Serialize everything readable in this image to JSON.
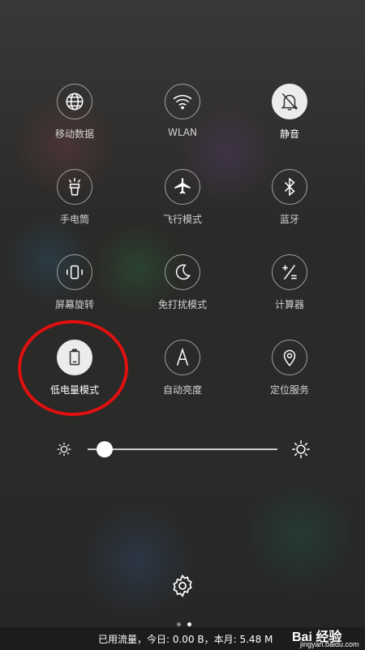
{
  "tiles": [
    {
      "label": "移动数据",
      "icon": "globe-icon",
      "active": false
    },
    {
      "label": "WLAN",
      "icon": "wifi-icon",
      "active": false
    },
    {
      "label": "静音",
      "icon": "bell-off-icon",
      "active": true
    },
    {
      "label": "手电筒",
      "icon": "flashlight-icon",
      "active": false
    },
    {
      "label": "飞行模式",
      "icon": "airplane-icon",
      "active": false
    },
    {
      "label": "蓝牙",
      "icon": "bluetooth-icon",
      "active": false
    },
    {
      "label": "屏幕旋转",
      "icon": "rotate-icon",
      "active": false
    },
    {
      "label": "免打扰模式",
      "icon": "moon-icon",
      "active": false
    },
    {
      "label": "计算器",
      "icon": "calculator-icon",
      "active": false
    },
    {
      "label": "低电量模式",
      "icon": "battery-icon",
      "active": true
    },
    {
      "label": "自动亮度",
      "icon": "auto-brightness-icon",
      "active": false
    },
    {
      "label": "定位服务",
      "icon": "location-icon",
      "active": false
    }
  ],
  "brightness": {
    "level_fraction": 0.09
  },
  "pager": {
    "pages": 2,
    "current": 2
  },
  "footer": {
    "data_usage": "已用流量，今日: 0.00 B，本月: 5.48 M"
  },
  "watermark": {
    "logo": "Bai 经验",
    "site": "jingyan.baidu.com"
  },
  "colors": {
    "highlight_ring": "#e01010",
    "active_tile": "#ececec"
  }
}
